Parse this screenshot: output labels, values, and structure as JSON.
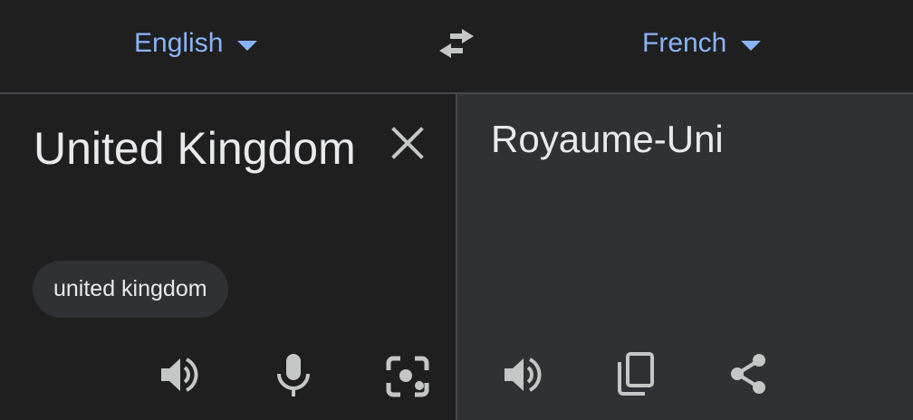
{
  "languages": {
    "source": "English",
    "target": "French"
  },
  "source": {
    "text": "United Kingdom",
    "suggestion": "united kingdom"
  },
  "target": {
    "text": "Royaume-Uni"
  },
  "colors": {
    "accent": "#8ab4f8",
    "text": "#e8eaed",
    "icon": "#c4c7c5",
    "background": "#1f1f20",
    "output_panel": "#303134"
  },
  "icons": {
    "swap": "swap-languages-icon",
    "clear": "close-icon",
    "listen": "speaker-icon",
    "voice": "microphone-icon",
    "camera": "camera-icon",
    "copy": "copy-icon",
    "share": "share-icon"
  }
}
